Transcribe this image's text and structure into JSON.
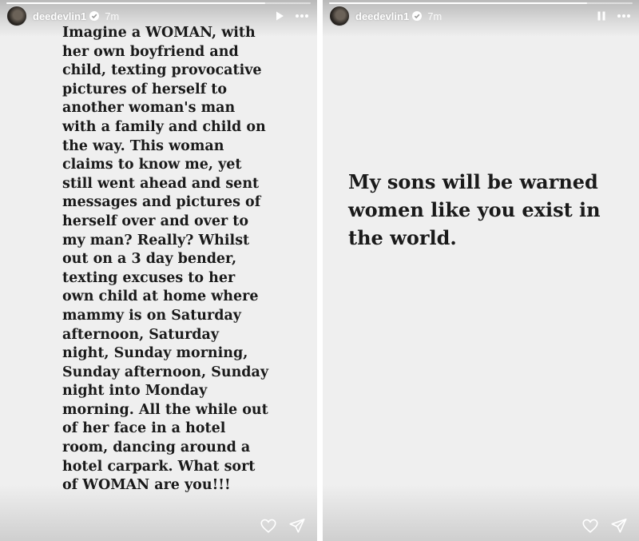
{
  "stories": [
    {
      "username": "deedevlin1",
      "time": "7m",
      "progress": 0.85,
      "playback": "play",
      "text": "Imagine a WOMAN, with her own boyfriend and child, texting provocative pictures of herself to another woman's man with a family and child on the way. This woman claims to know me, yet still went ahead and sent messages and pictures of herself over and over to my man? Really? Whilst out on a 3 day bender, texting excuses to her own child at home where mammy is on Saturday afternoon, Saturday night, Sunday morning, Sunday afternoon, Sunday night into Monday morning. All the while out of her face in a hotel room, dancing around a hotel carpark. What sort of WOMAN are you!!!"
    },
    {
      "username": "deedevlin1",
      "time": "7m",
      "progress": 0.85,
      "playback": "pause",
      "text": "My sons will be warned women like you exist in the world."
    }
  ]
}
